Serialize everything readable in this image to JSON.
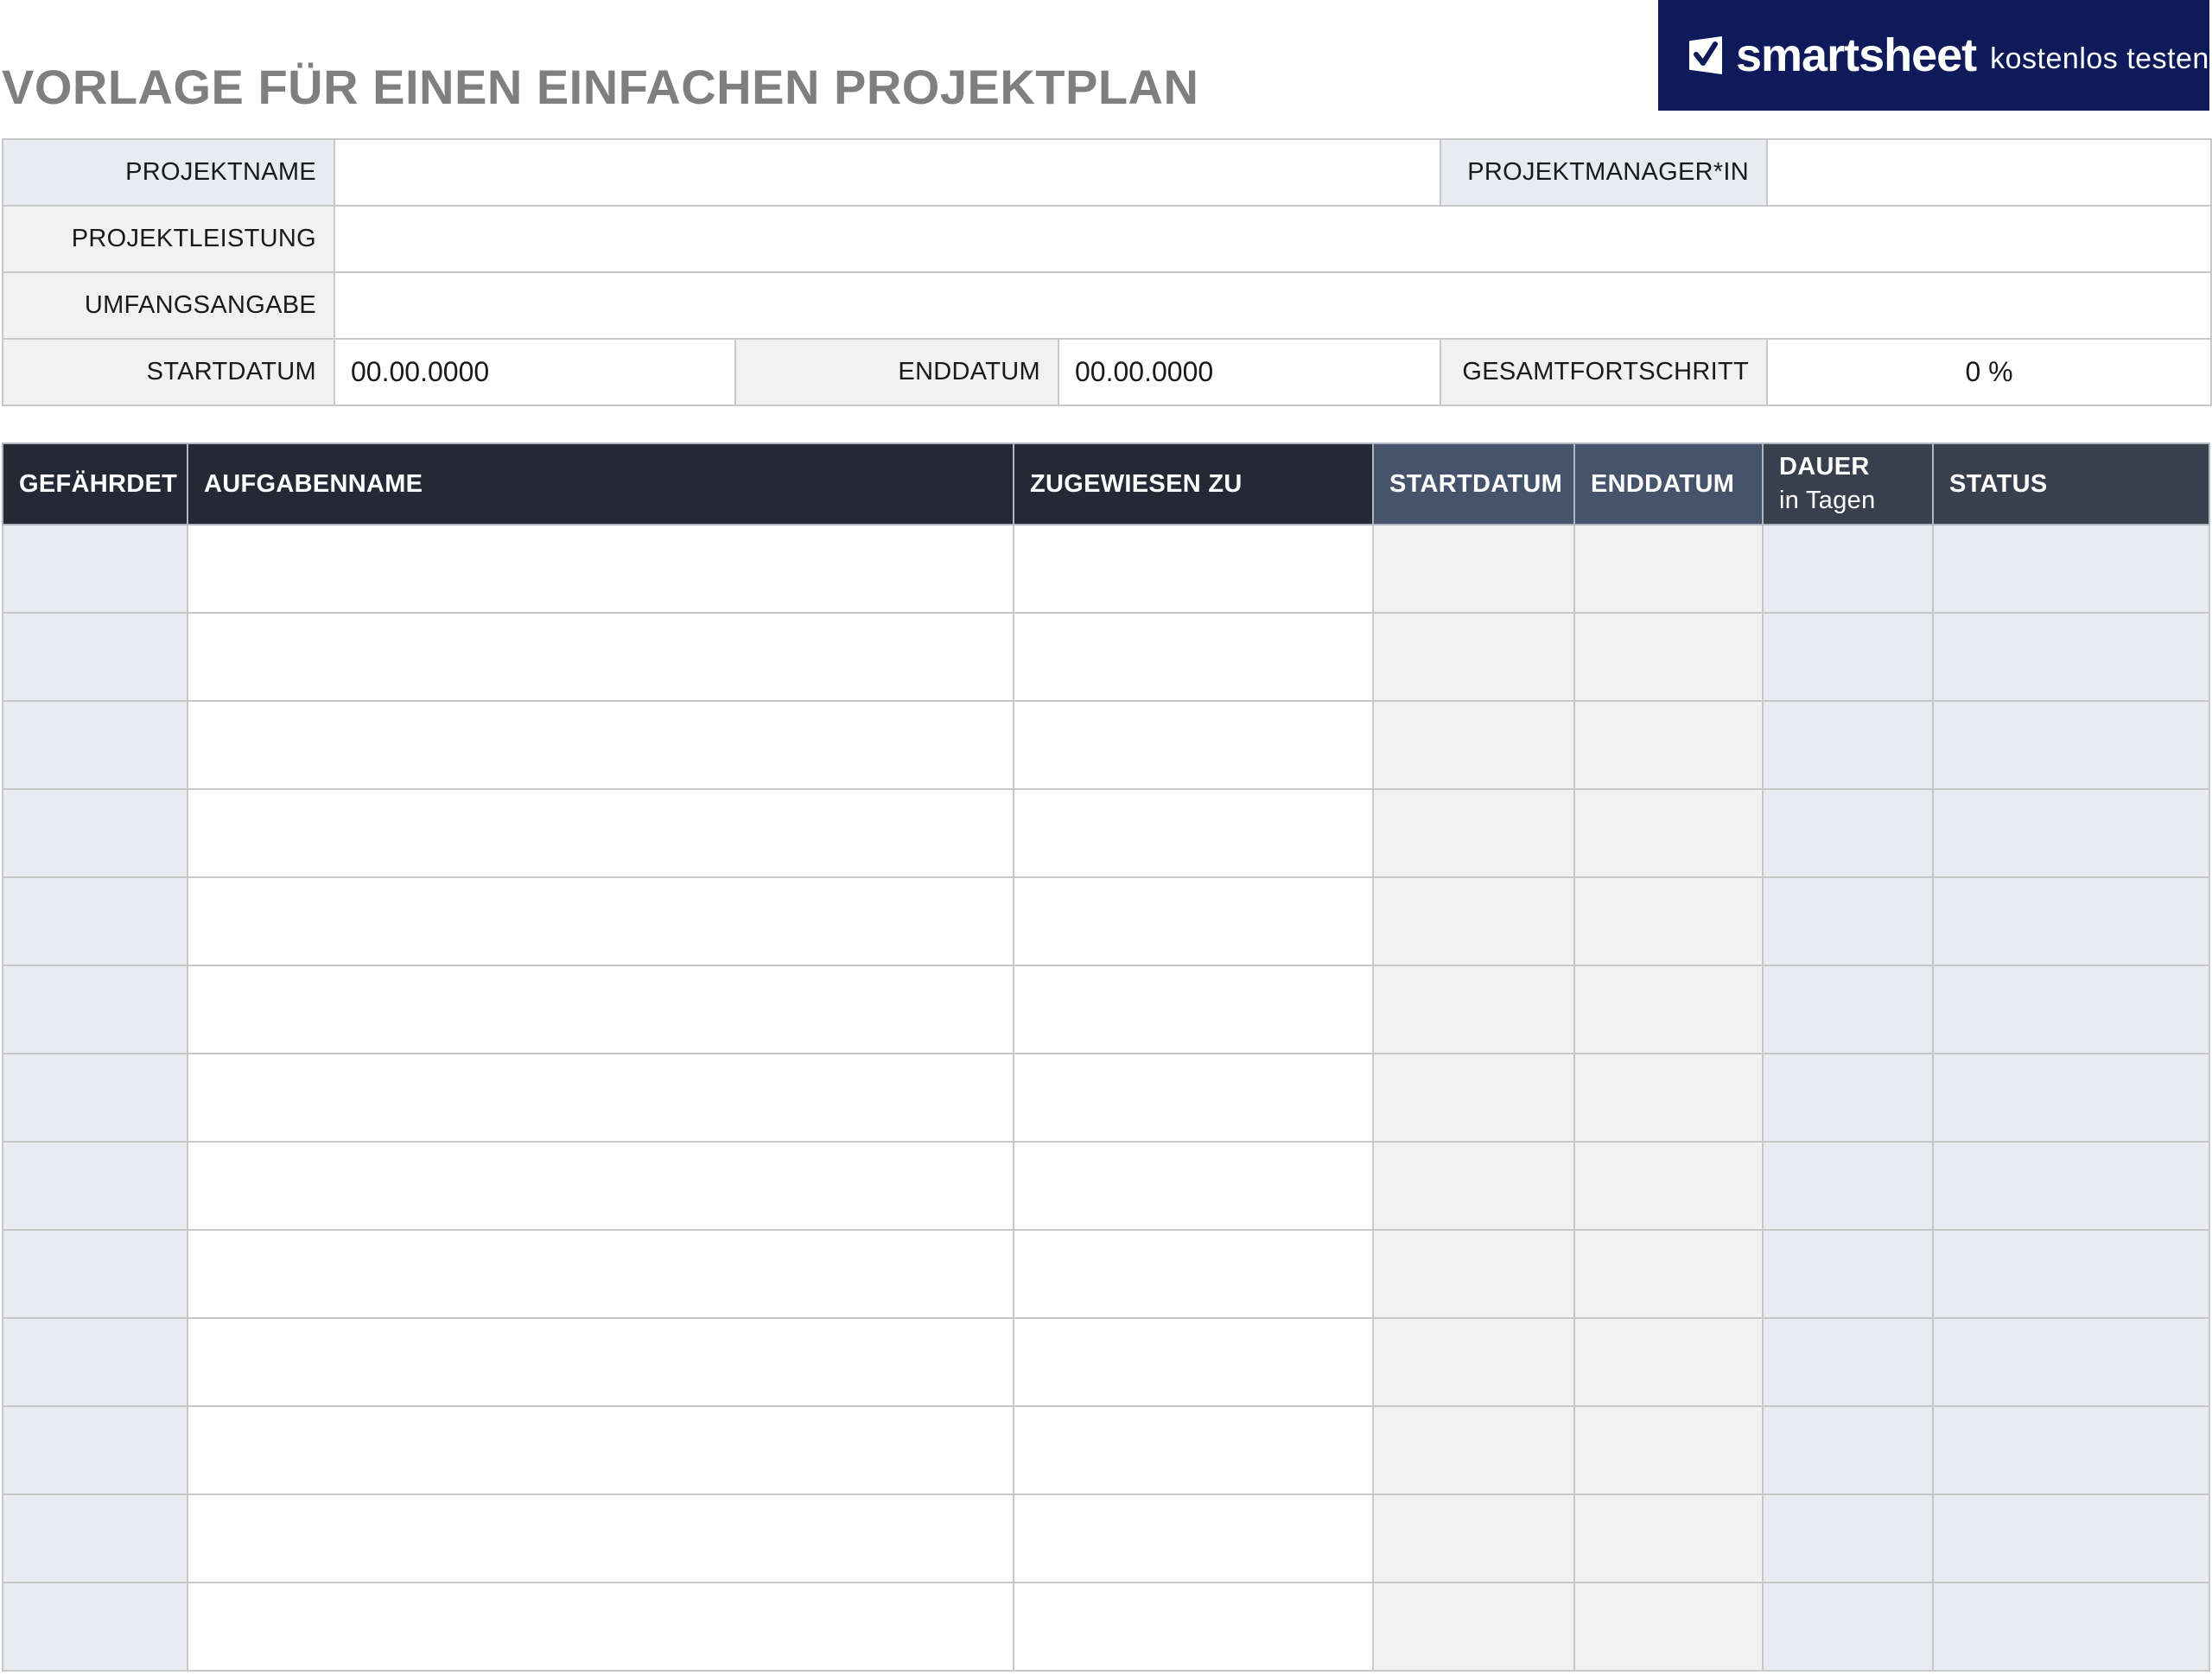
{
  "title": "VORLAGE FÜR EINEN EINFACHEN PROJEKTPLAN",
  "banner": {
    "brand": "smartsheet",
    "cta": "kostenlos testen",
    "icon": "checkmark-logo-icon",
    "background": "#0f1a5a"
  },
  "info": {
    "project_name_label": "PROJEKTNAME",
    "project_name_value": "",
    "project_manager_label": "PROJEKTMANAGER*IN",
    "project_manager_value": "",
    "deliverable_label": "PROJEKTLEISTUNG",
    "deliverable_value": "",
    "scope_label": "UMFANGSANGABE",
    "scope_value": "",
    "start_label": "STARTDATUM",
    "start_value": "00.00.0000",
    "end_label": "ENDDATUM",
    "end_value": "00.00.0000",
    "progress_label": "GESAMTFORTSCHRITT",
    "progress_value": "0 %"
  },
  "tasks": {
    "columns": {
      "at_risk": "GEFÄHRDET",
      "task_name": "AUFGABENNAME",
      "assigned_to": "ZUGEWIESEN ZU",
      "start": "STARTDATUM",
      "end": "ENDDATUM",
      "duration": "DAUER",
      "duration_unit": "in Tagen",
      "status": "STATUS"
    },
    "row_count": 13,
    "header_colors": {
      "dark": "#232a36",
      "slate": "#46546b"
    }
  }
}
